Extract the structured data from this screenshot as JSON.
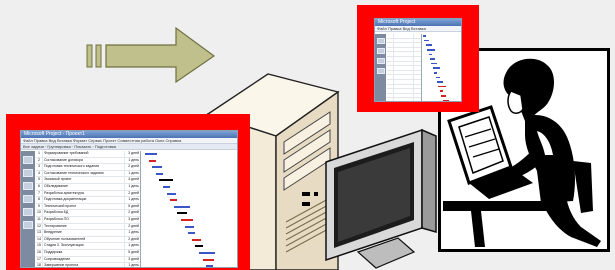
{
  "large_screenshot": {
    "title": "Microsoft Project - Проект1",
    "menu": [
      "Файл",
      "Правка",
      "Вид",
      "Вставка",
      "Формат",
      "Сервис",
      "Проект",
      "Совместная работа",
      "Окно",
      "Справка"
    ],
    "toolbar_text": "Все задачи · Группировка · Показать · Подготовка",
    "columns": [
      "Название задачи",
      "Длительность"
    ],
    "tasks": [
      {
        "id": "1",
        "name": "Формирование требований",
        "duration": "3 дней"
      },
      {
        "id": "2",
        "name": "Согласование договора",
        "duration": "1 день"
      },
      {
        "id": "3",
        "name": "Подготовка технического задания",
        "duration": "2 дней"
      },
      {
        "id": "4",
        "name": "Согласование технического задания",
        "duration": "1 день"
      },
      {
        "id": "5",
        "name": "Эскизный проект",
        "duration": "4 дней"
      },
      {
        "id": "6",
        "name": "Обследование",
        "duration": "1 день"
      },
      {
        "id": "7",
        "name": "Разработка архитектуры",
        "duration": "2 дней"
      },
      {
        "id": "8",
        "name": "Подготовка документации",
        "duration": "1 день"
      },
      {
        "id": "9",
        "name": "Технический проект",
        "duration": "5 дней"
      },
      {
        "id": "10",
        "name": "Разработка БД",
        "duration": "2 дней"
      },
      {
        "id": "11",
        "name": "Разработка ПО",
        "duration": "3 дней"
      },
      {
        "id": "12",
        "name": "Тестирование",
        "duration": "2 дней"
      },
      {
        "id": "13",
        "name": "Внедрение",
        "duration": "1 день"
      },
      {
        "id": "14",
        "name": "Обучение пользователей",
        "duration": "2 дней"
      },
      {
        "id": "15",
        "name": "Стадия 3. Эксплуатация",
        "duration": "1 день"
      },
      {
        "id": "16",
        "name": "Поддержка",
        "duration": "5 дней"
      },
      {
        "id": "17",
        "name": "Сопровождение",
        "duration": "3 дней"
      },
      {
        "id": "18",
        "name": "Завершение проекта",
        "duration": "1 день"
      },
      {
        "id": "19",
        "name": "Сдача проекта",
        "duration": "1 день"
      },
      {
        "id": "20",
        "name": "Закрытие проекта",
        "duration": "0 дней"
      }
    ]
  },
  "small_screenshot": {
    "title": "Microsoft Project",
    "menu": [
      "Файл",
      "Правка",
      "Вид",
      "Вставка"
    ],
    "task_count": 22
  },
  "colors": {
    "frame_red": "#ff0000",
    "arrow_fill": "#bfc08b",
    "arrow_stroke": "#6f7040",
    "server_body": "#f6eedd",
    "gantt_blue": "#3a55c8",
    "gantt_red": "#d42323"
  },
  "icons": {
    "arrow": "right-arrow-icon",
    "server": "server-tower-icon",
    "monitor": "monitor-icon",
    "person": "person-at-computer-icon"
  }
}
